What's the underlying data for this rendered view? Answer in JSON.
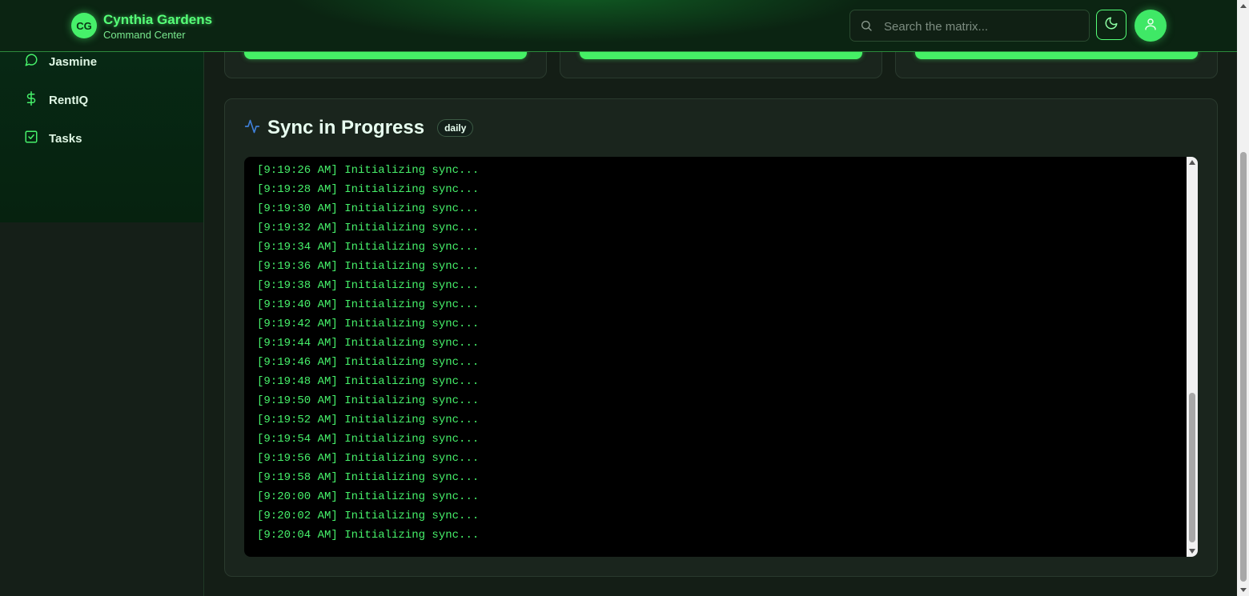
{
  "header": {
    "logo_initials": "CG",
    "brand_title": "Cynthia Gardens",
    "brand_subtitle": "Command Center",
    "search_placeholder": "Search the matrix..."
  },
  "sidebar": {
    "items": [
      {
        "label": "Jasmine",
        "icon": "chat-bubble-icon"
      },
      {
        "label": "RentIQ",
        "icon": "dollar-icon"
      },
      {
        "label": "Tasks",
        "icon": "checkbox-icon"
      }
    ]
  },
  "sync": {
    "title": "Sync in Progress",
    "badge": "daily",
    "log_lines": [
      "[9:19:26 AM] Initializing sync...",
      "[9:19:28 AM] Initializing sync...",
      "[9:19:30 AM] Initializing sync...",
      "[9:19:32 AM] Initializing sync...",
      "[9:19:34 AM] Initializing sync...",
      "[9:19:36 AM] Initializing sync...",
      "[9:19:38 AM] Initializing sync...",
      "[9:19:40 AM] Initializing sync...",
      "[9:19:42 AM] Initializing sync...",
      "[9:19:44 AM] Initializing sync...",
      "[9:19:46 AM] Initializing sync...",
      "[9:19:48 AM] Initializing sync...",
      "[9:19:50 AM] Initializing sync...",
      "[9:19:52 AM] Initializing sync...",
      "[9:19:54 AM] Initializing sync...",
      "[9:19:56 AM] Initializing sync...",
      "[9:19:58 AM] Initializing sync...",
      "[9:20:00 AM] Initializing sync...",
      "[9:20:02 AM] Initializing sync...",
      "[9:20:04 AM] Initializing sync..."
    ]
  },
  "colors": {
    "accent": "#46f06a",
    "background": "#141e16",
    "console_bg": "#000000"
  }
}
